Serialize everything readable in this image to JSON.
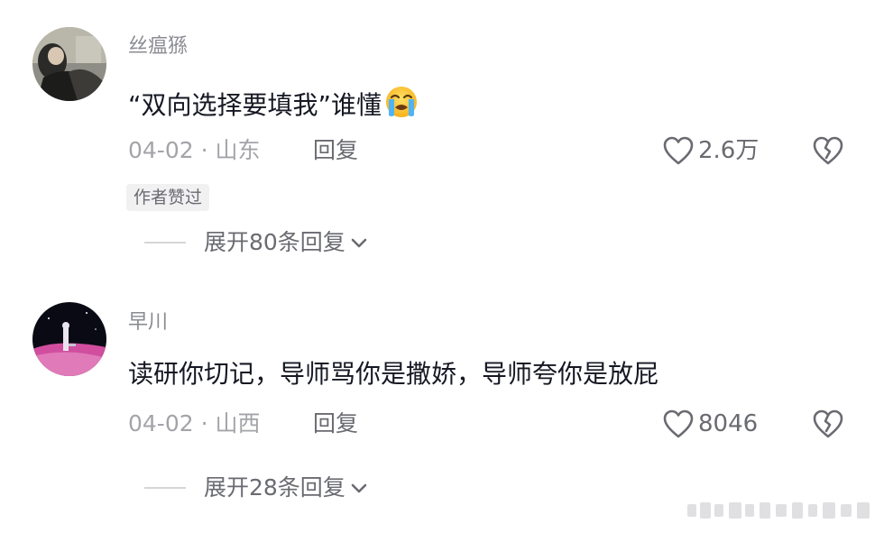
{
  "comments": [
    {
      "username": "丝瘟猻",
      "text": "“双向选择要填我”谁懂",
      "emoji": "loudly-crying-face",
      "date": "04-02",
      "separator": "·",
      "location": "山东",
      "reply_label": "回复",
      "likes": "2.6万",
      "badge": "作者赞过",
      "expand_label": "展开80条回复"
    },
    {
      "username": "早川",
      "text": "读研你切记，导师骂你是撒娇，导师夸你是放屁",
      "date": "04-02",
      "separator": "·",
      "location": "山西",
      "reply_label": "回复",
      "likes": "8046",
      "expand_label": "展开28条回复"
    }
  ],
  "colors": {
    "text_primary": "#161823",
    "text_secondary": "#8a8b91",
    "meta": "#a3a4a9",
    "action": "#6a6b71",
    "badge_bg": "#f1f1f2"
  }
}
